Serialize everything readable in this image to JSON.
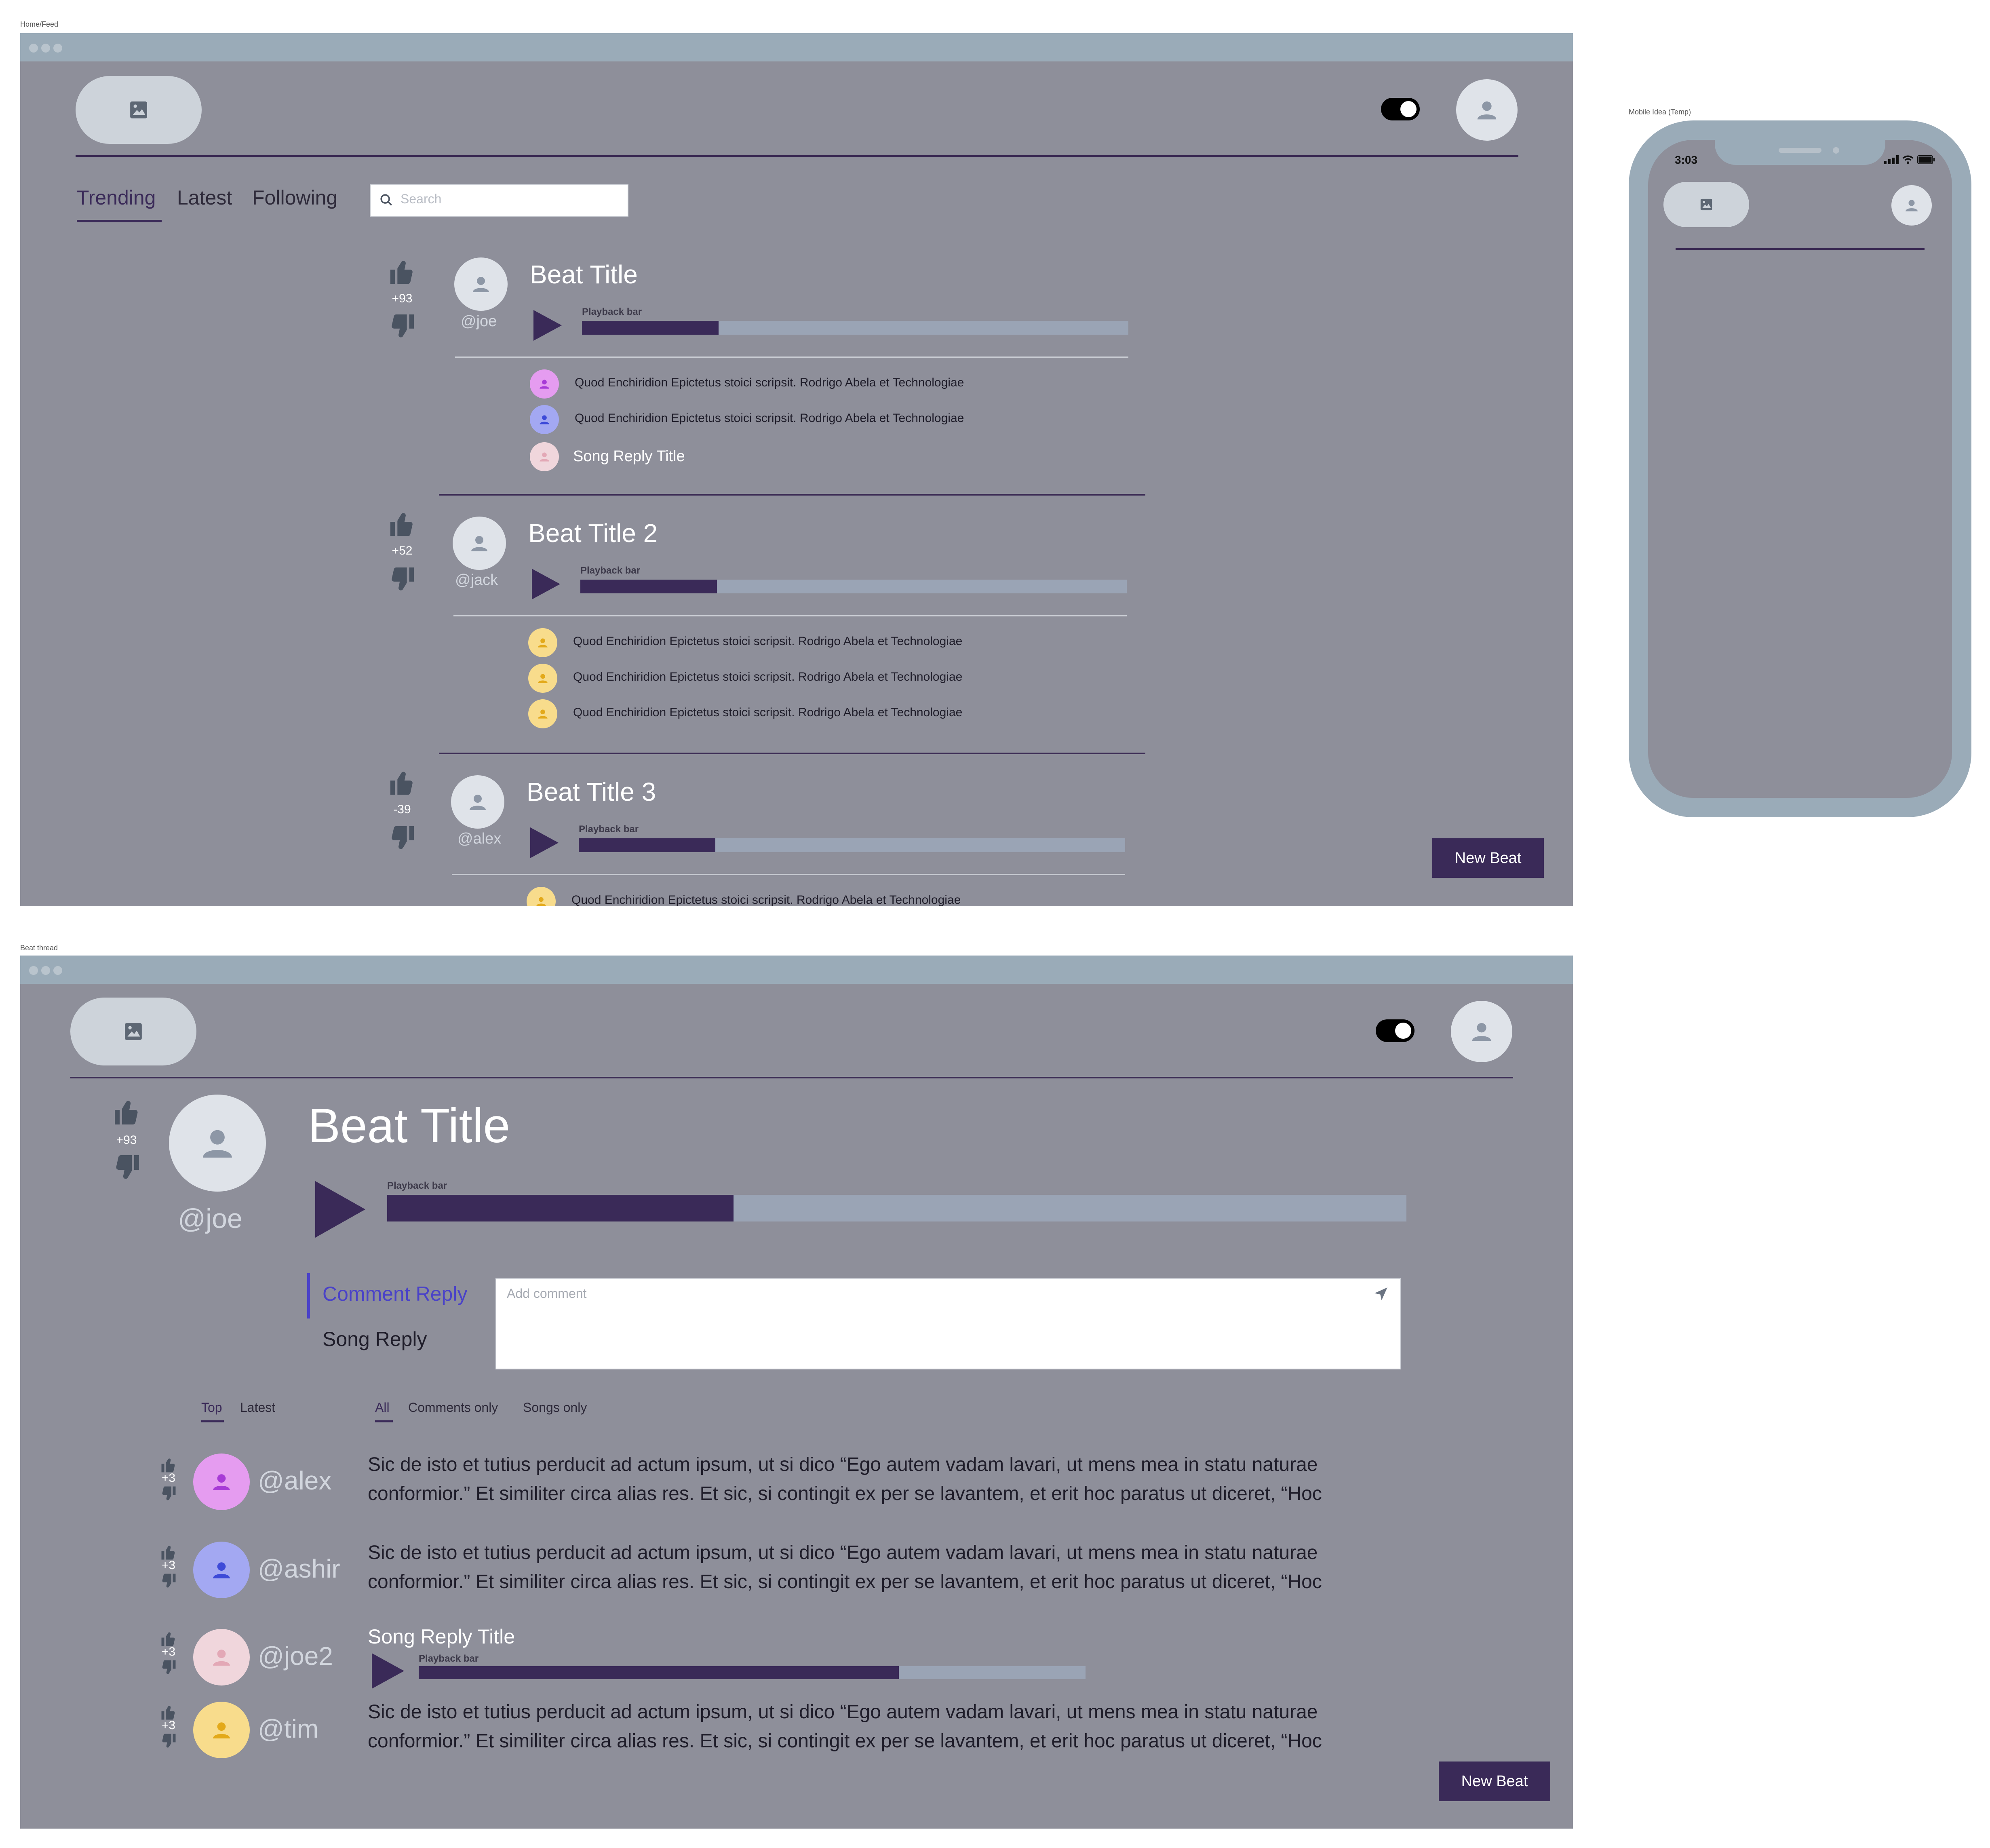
{
  "frames": {
    "feed_label": "Home/Feed",
    "thread_label": "Beat thread",
    "mobile_label": "Mobile Idea (Temp)"
  },
  "colors": {
    "background": "#8e8f9a",
    "window_bar": "#9aabb8",
    "accent": "#3a2a58",
    "active_reply_tab": "#4a42c8"
  },
  "feed": {
    "tabs": [
      {
        "label": "Trending",
        "active": true
      },
      {
        "label": "Latest",
        "active": false
      },
      {
        "label": "Following",
        "active": false
      }
    ],
    "search_placeholder": "Search",
    "posts": [
      {
        "votes": "+93",
        "handle": "@joe",
        "title": "Beat Title",
        "playback_label": "Playback bar",
        "progress": 0.25,
        "replies": [
          {
            "type": "comment",
            "text": "Quod Enchiridion Epictetus stoici scripsit. Rodrigo Abela et Technologiae",
            "avatar_color": "#e59cf0",
            "icon_color": "#a73ad6"
          },
          {
            "type": "comment",
            "text": "Quod Enchiridion Epictetus stoici scripsit. Rodrigo Abela et Technologiae",
            "avatar_color": "#a3a8f2",
            "icon_color": "#3d4ad8"
          },
          {
            "type": "song",
            "text": "Song Reply Title",
            "avatar_color": "#f0d6dc",
            "icon_color": "#e3a8b6"
          }
        ]
      },
      {
        "votes": "+52",
        "handle": "@jack",
        "title": "Beat Title 2",
        "playback_label": "Playback bar",
        "progress": 0.25,
        "replies": [
          {
            "type": "comment",
            "text": "Quod Enchiridion Epictetus stoici scripsit. Rodrigo Abela et Technologiae",
            "avatar_color": "#f8dc8c",
            "icon_color": "#e3a91a"
          },
          {
            "type": "comment",
            "text": "Quod Enchiridion Epictetus stoici scripsit. Rodrigo Abela et Technologiae",
            "avatar_color": "#f8dc8c",
            "icon_color": "#e3a91a"
          },
          {
            "type": "comment",
            "text": "Quod Enchiridion Epictetus stoici scripsit. Rodrigo Abela et Technologiae",
            "avatar_color": "#f8dc8c",
            "icon_color": "#e3a91a"
          }
        ]
      },
      {
        "votes": "-39",
        "handle": "@alex",
        "title": "Beat Title 3",
        "playback_label": "Playback bar",
        "progress": 0.25,
        "replies": [
          {
            "type": "comment",
            "text": "Quod Enchiridion Epictetus stoici scripsit. Rodrigo Abela et Technologiae",
            "avatar_color": "#f8dc8c",
            "icon_color": "#e3a91a"
          }
        ]
      }
    ],
    "new_beat_label": "New Beat"
  },
  "thread": {
    "votes": "+93",
    "handle": "@joe",
    "title": "Beat Title",
    "playback_label": "Playback bar",
    "progress": 0.34,
    "reply_tabs": [
      {
        "label": "Comment Reply",
        "active": true
      },
      {
        "label": "Song Reply",
        "active": false
      }
    ],
    "comment_placeholder": "Add comment",
    "sort_tabs": [
      {
        "label": "Top",
        "active": true
      },
      {
        "label": "Latest",
        "active": false
      }
    ],
    "filter_tabs": [
      {
        "label": "All",
        "active": true
      },
      {
        "label": "Comments only",
        "active": false
      },
      {
        "label": "Songs only",
        "active": false
      }
    ],
    "comments": [
      {
        "type": "comment",
        "handle": "@alex",
        "votes": "+3",
        "avatar_color": "#e59cf0",
        "icon_color": "#a73ad6",
        "line1": "Sic de isto et tutius perducit ad actum ipsum, ut si dico “Ego autem vadam lavari, ut mens mea in statu naturae",
        "line2": "conformior.” Et similiter circa alias res. Et sic, si contingit ex per se lavantem, et erit hoc paratus ut diceret, “Hoc"
      },
      {
        "type": "comment",
        "handle": "@ashir",
        "votes": "+3",
        "avatar_color": "#a3a8f2",
        "icon_color": "#3d4ad8",
        "line1": "Sic de isto et tutius perducit ad actum ipsum, ut si dico “Ego autem vadam lavari, ut mens mea in statu naturae",
        "line2": "conformior.” Et similiter circa alias res. Et sic, si contingit ex per se lavantem, et erit hoc paratus ut diceret, “Hoc"
      },
      {
        "type": "song",
        "handle": "@joe2",
        "votes": "+3",
        "avatar_color": "#f0d6dc",
        "icon_color": "#e3a8b6",
        "title": "Song Reply Title",
        "playback_label": "Playback bar",
        "progress": 0.72
      },
      {
        "type": "comment",
        "handle": "@tim",
        "votes": "+3",
        "avatar_color": "#f8dc8c",
        "icon_color": "#e3a91a",
        "line1": "Sic de isto et tutius perducit ad actum ipsum, ut si dico “Ego autem vadam lavari, ut mens mea in statu naturae",
        "line2": "conformior.” Et similiter circa alias res. Et sic, si contingit ex per se lavantem, et erit hoc paratus ut diceret, “Hoc"
      }
    ],
    "new_beat_label": "New Beat"
  },
  "mobile": {
    "time": "3:03"
  },
  "icons": {
    "logo": "image-icon",
    "profile": "user-icon",
    "upvote": "thumbs-up-icon",
    "downvote": "thumbs-down-icon",
    "play": "play-icon",
    "search": "search-icon",
    "send": "send-icon",
    "theme": "toggle-icon"
  }
}
